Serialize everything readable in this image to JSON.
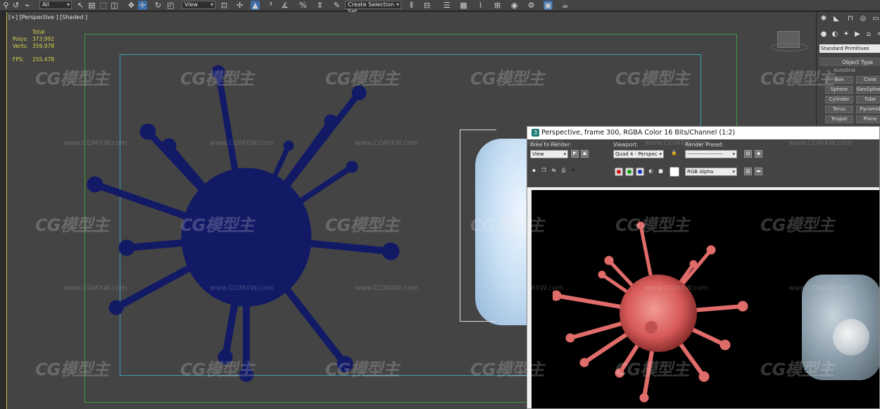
{
  "toolbar": {
    "filter_select": "All",
    "ref_coord_select": "View",
    "named_selection_select": "Create Selection Set"
  },
  "viewport": {
    "label": "[+] [Perspective ] [Shaded ]",
    "stats": {
      "total_label": "Total",
      "polys_label": "Polys:",
      "polys_value": "373,992",
      "verts_label": "Verts:",
      "verts_value": "359,978",
      "fps_label": "FPS:",
      "fps_value": "255.478"
    }
  },
  "command_panel": {
    "category_dropdown": "Standard Primitives",
    "rollout_title": "Object Type",
    "autogrid_label": "AutoGrid",
    "buttons": [
      "Box",
      "Cone",
      "Sphere",
      "GeoSphere",
      "Cylinder",
      "Tube",
      "Torus",
      "Pyramid",
      "Teapot",
      "Plane"
    ]
  },
  "render_window": {
    "title": "Perspective, frame 300, RGBA Color 16 Bits/Channel (1:2)",
    "area_to_render_label": "Area to Render:",
    "area_to_render_value": "View",
    "viewport_label": "Viewport:",
    "viewport_value": "Quad 4 - Perspec",
    "render_preset_label": "Render Preset:",
    "render_preset_value": "--------------------",
    "channel_value": "RGB Alpha"
  },
  "watermark": {
    "logo_text": "CG模型主",
    "url_text": "www.CGMXW.com"
  },
  "colors": {
    "viewport_bg": "#444444",
    "safe_frame_outer": "#3d9a3d",
    "safe_frame_inner": "#3aa0b8",
    "stats_text": "#d8d24a",
    "blue_virus": "#121a66",
    "pink_virus": "#e06c6a"
  }
}
